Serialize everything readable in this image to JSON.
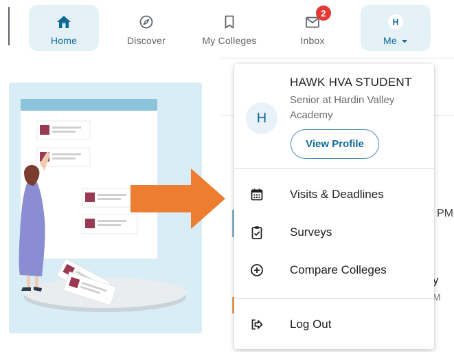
{
  "nav": {
    "items": [
      {
        "label": "Home",
        "icon": "home-icon"
      },
      {
        "label": "Discover",
        "icon": "compass-icon"
      },
      {
        "label": "My Colleges",
        "icon": "bookmark-icon"
      },
      {
        "label": "Inbox",
        "icon": "mail-icon",
        "badge": "2"
      },
      {
        "label": "Me",
        "icon": "avatar",
        "initial": "H"
      }
    ]
  },
  "background": {
    "edge_text_1": "PM",
    "edge_text_2": "y",
    "edge_text_3": "M"
  },
  "dropdown": {
    "profile": {
      "initial": "H",
      "name": "HAWK HVA STUDENT",
      "subtitle": "Senior at Hardin Valley Academy",
      "button": "View Profile"
    },
    "menu": [
      {
        "label": "Visits & Deadlines",
        "icon": "calendar-icon"
      },
      {
        "label": "Surveys",
        "icon": "clipboard-check-icon"
      },
      {
        "label": "Compare Colleges",
        "icon": "plus-circle-icon"
      },
      {
        "label": "Log Out",
        "icon": "logout-icon"
      }
    ]
  },
  "colors": {
    "accent": "#0d6a96",
    "active_bg": "#e4f1f7",
    "badge": "#e53935",
    "annotation_arrow": "#ed7d31"
  }
}
